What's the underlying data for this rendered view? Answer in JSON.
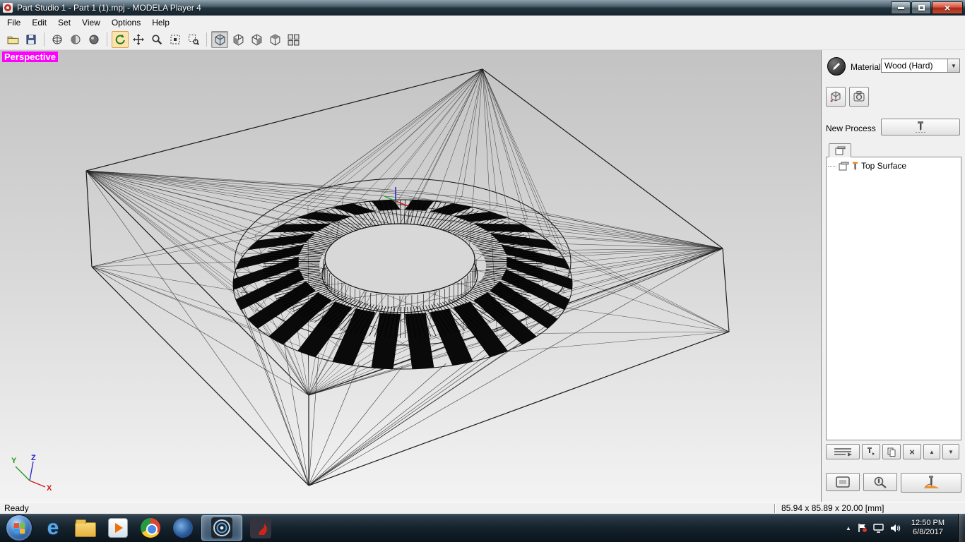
{
  "window": {
    "title": "Part Studio 1 - Part 1 (1).mpj - MODELA Player 4"
  },
  "menu": {
    "items": [
      "File",
      "Edit",
      "Set",
      "View",
      "Options",
      "Help"
    ]
  },
  "viewport": {
    "label": "Perspective",
    "axis": {
      "x": "X",
      "y": "Y",
      "z": "Z"
    }
  },
  "right_panel": {
    "material_label": "Material",
    "material_value": "Wood (Hard)",
    "new_process_label": "New Process",
    "tree": {
      "items": [
        {
          "label": "Top Surface"
        }
      ]
    }
  },
  "status_bar": {
    "ready": "Ready",
    "dimensions": "85.94 x 85.89 x 20.00 [mm]"
  },
  "taskbar": {
    "clock": {
      "time": "12:50 PM",
      "date": "6/8/2017"
    }
  },
  "colors": {
    "perspective_magenta": "#ff00ff",
    "close_button_red": "#c24a2f",
    "taskbar_active_glow": "#aacdf0"
  }
}
